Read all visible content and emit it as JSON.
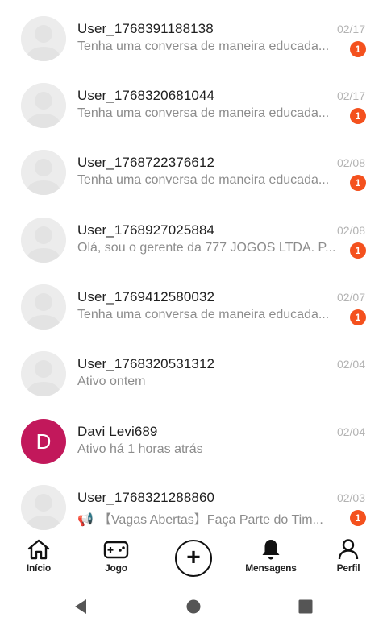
{
  "chats": [
    {
      "name": "User_1768391188138",
      "date": "02/17",
      "preview": "Tenha uma conversa de maneira educada...",
      "badge": "1",
      "avatar": "default-avatar-icon"
    },
    {
      "name": "User_1768320681044",
      "date": "02/17",
      "preview": "Tenha uma conversa de maneira educada...",
      "badge": "1",
      "avatar": "default-avatar-icon"
    },
    {
      "name": "User_1768722376612",
      "date": "02/08",
      "preview": "Tenha uma conversa de maneira educada...",
      "badge": "1",
      "avatar": "default-avatar-icon"
    },
    {
      "name": "User_1768927025884",
      "date": "02/08",
      "preview": "Olá, sou o gerente da 777 JOGOS LTDA. P...",
      "badge": "1",
      "avatar": "default-avatar-icon"
    },
    {
      "name": "User_1769412580032",
      "date": "02/07",
      "preview": "Tenha uma conversa de maneira educada...",
      "badge": "1",
      "avatar": "default-avatar-icon"
    },
    {
      "name": "User_1768320531312",
      "date": "02/04",
      "preview": "Ativo ontem",
      "badge": "",
      "avatar": "default-avatar-icon"
    },
    {
      "name": "Davi Levi689",
      "date": "02/04",
      "preview": "Ativo há 1 horas atrás",
      "badge": "",
      "avatar_letter": "D",
      "avatar_color": "#c2185b"
    },
    {
      "name": "User_1768321288860",
      "date": "02/03",
      "preview": "【Vagas Abertas】Faça Parte do Tim...",
      "preview_icon": "megaphone-icon",
      "badge": "1",
      "avatar": "default-avatar-icon"
    }
  ],
  "tabs": {
    "home": {
      "label": "Início",
      "icon": "home-icon"
    },
    "game": {
      "label": "Jogo",
      "icon": "gamepad-icon"
    },
    "create": {
      "icon": "plus-circle-icon"
    },
    "messages": {
      "label": "Mensagens",
      "icon": "bell-icon"
    },
    "profile": {
      "label": "Perfil",
      "icon": "person-icon"
    }
  },
  "system_nav": {
    "back": "back-triangle-icon",
    "home": "home-circle-icon",
    "recents": "recents-square-icon"
  },
  "colors": {
    "badge": "#f4511e",
    "avatar_d": "#c2185b",
    "muted_text": "#8c8c8c",
    "date_text": "#b3b3b3"
  }
}
